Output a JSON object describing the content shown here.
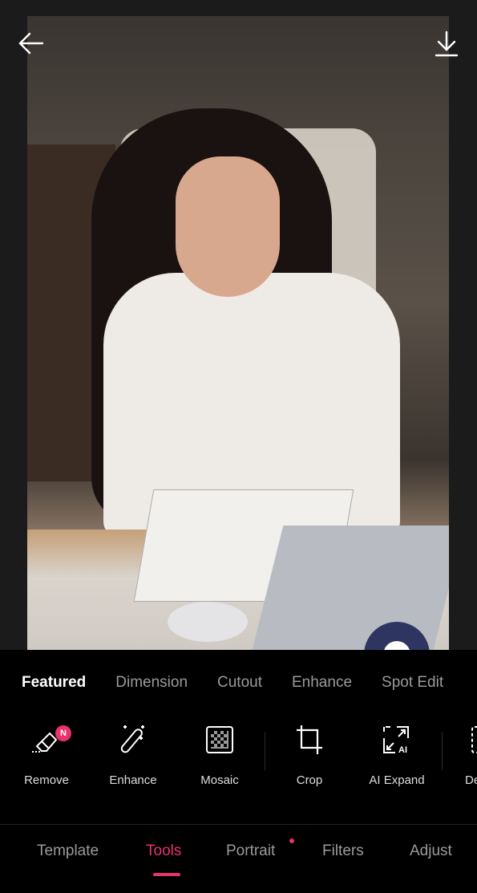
{
  "colors": {
    "accent": "#e8336b",
    "fab": "#2f3561"
  },
  "header": {
    "back_icon": "arrow-left-icon",
    "download_icon": "download-icon"
  },
  "categories": [
    {
      "label": "Featured",
      "active": true
    },
    {
      "label": "Dimension"
    },
    {
      "label": "Cutout"
    },
    {
      "label": "Enhance"
    },
    {
      "label": "Spot Edit"
    }
  ],
  "tools": [
    {
      "label": "Remove",
      "icon": "eraser-icon",
      "badge": "N"
    },
    {
      "label": "Enhance",
      "icon": "magic-wand-icon"
    },
    {
      "label": "Mosaic",
      "icon": "mosaic-icon"
    },
    {
      "label": "Crop",
      "icon": "crop-icon"
    },
    {
      "label": "AI Expand",
      "icon": "ai-expand-icon"
    },
    {
      "label": "De",
      "icon": "partial-icon"
    }
  ],
  "nav": [
    {
      "label": "Template"
    },
    {
      "label": "Tools",
      "active": true
    },
    {
      "label": "Portrait",
      "dot": true
    },
    {
      "label": "Filters"
    },
    {
      "label": "Adjust"
    }
  ]
}
